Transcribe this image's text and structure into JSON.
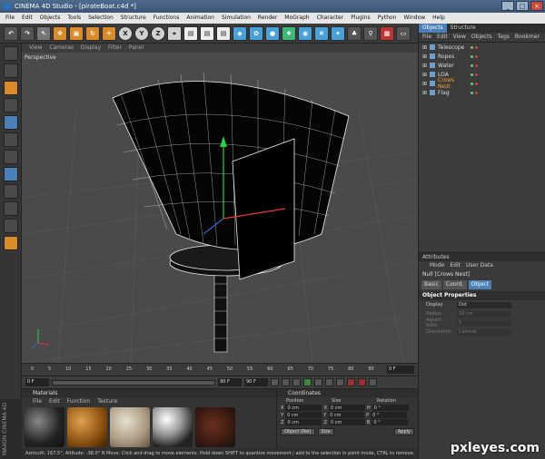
{
  "window": {
    "title": "CINEMA 4D Studio - [pirateBoat.c4d *]"
  },
  "menu": [
    "File",
    "Edit",
    "Objects",
    "Tools",
    "Selection",
    "Structure",
    "Functions",
    "Animation",
    "Simulation",
    "Render",
    "MoGraph",
    "Character",
    "Plugins",
    "Python",
    "Window",
    "Help"
  ],
  "viewport": {
    "menu": [
      "View",
      "Cameras",
      "Display",
      "Filter",
      "Panel"
    ],
    "label": "Perspective"
  },
  "timeline": {
    "ticks": [
      "0",
      "5",
      "10",
      "15",
      "20",
      "25",
      "30",
      "35",
      "40",
      "45",
      "50",
      "55",
      "60",
      "65",
      "70",
      "75",
      "80",
      "85",
      "90"
    ],
    "current_frame": "0 F"
  },
  "transport": {
    "start": "0 F",
    "end": "90 F",
    "end2": "90 F"
  },
  "materials": {
    "title": "Materials",
    "menu": [
      "File",
      "Edit",
      "Function",
      "Texture"
    ]
  },
  "coordinates": {
    "title": "Coordinates",
    "headers": [
      "Position",
      "Size",
      "Rotation"
    ],
    "rows": [
      {
        "a": "X",
        "p": "0 cm",
        "b": "X",
        "s": "0 cm",
        "c": "H",
        "r": "0 °"
      },
      {
        "a": "Y",
        "p": "0 cm",
        "b": "Y",
        "s": "0 cm",
        "c": "P",
        "r": "0 °"
      },
      {
        "a": "Z",
        "p": "0 cm",
        "b": "Z",
        "s": "0 cm",
        "c": "B",
        "r": "0 °"
      }
    ],
    "mode": "Object (Rel)",
    "size_mode": "Size",
    "apply": "Apply"
  },
  "status": "Azimuth: 167.5°, Altitude: -38.0° N   Move: Click and drag to move elements. Hold down SHIFT to quantize movement / add to the selection in point mode, CTRL to remove.",
  "brand": "MAXON CINEMA 4D",
  "objects": {
    "tabs": [
      "Objects",
      "Structure"
    ],
    "menu": [
      "File",
      "Edit",
      "View",
      "Objects",
      "Tags",
      "Bookmar"
    ],
    "items": [
      {
        "name": "Telescope"
      },
      {
        "name": "Ropes"
      },
      {
        "name": "Water"
      },
      {
        "name": "LOA"
      },
      {
        "name": "Crows Nest",
        "selected": true
      },
      {
        "name": "Flag"
      }
    ]
  },
  "attributes": {
    "title": "Attributes",
    "menu": [
      "Mode",
      "Edit",
      "User Data"
    ],
    "object": "Null [Crows Nest]",
    "tabs": [
      "Basic",
      "Coord.",
      "Object"
    ],
    "section": "Object Properties",
    "props": [
      {
        "label": "Display",
        "value": "Dot"
      },
      {
        "label": "Radius",
        "value": "10 cm"
      },
      {
        "label": "Aspect Ratio",
        "value": "1"
      },
      {
        "label": "Orientation",
        "value": "Camera"
      }
    ]
  },
  "watermark": "pxleyes.com",
  "colors": {
    "accent": "#4a7fb8",
    "selected": "#f0a030",
    "viewport": "#4a4a4a"
  }
}
